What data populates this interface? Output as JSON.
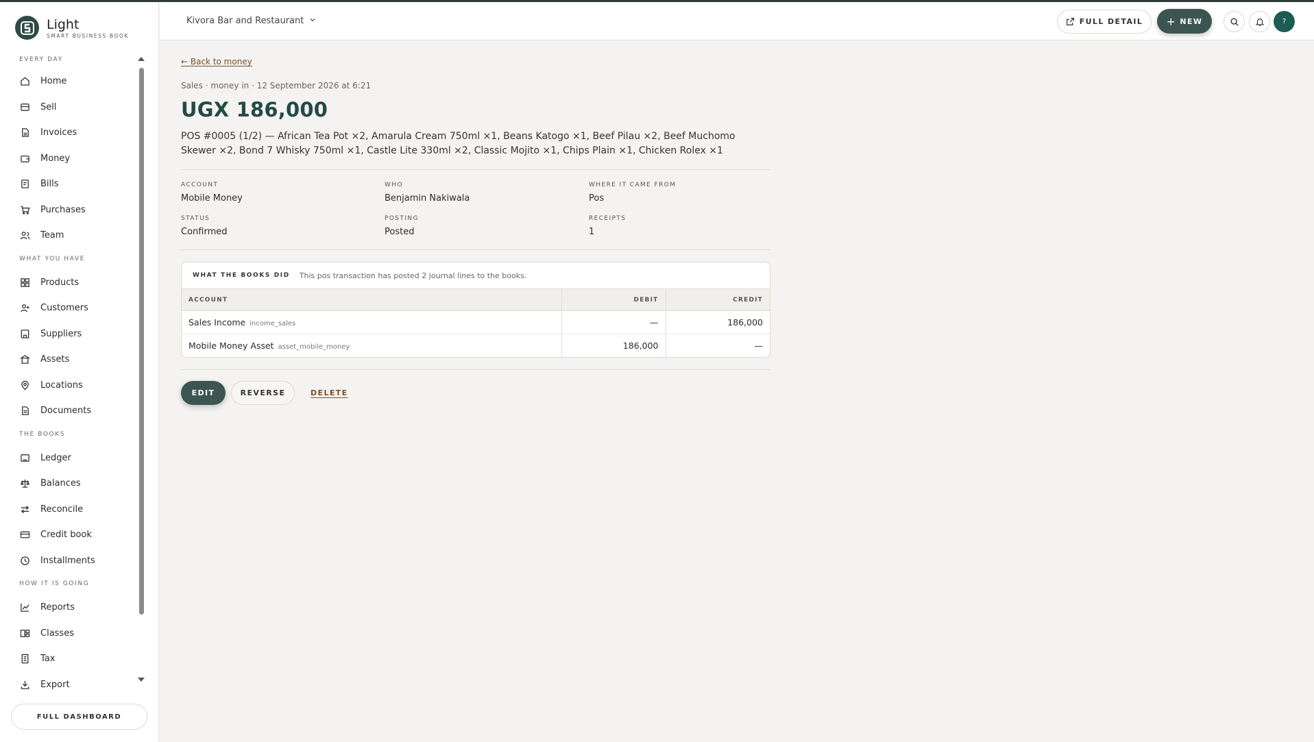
{
  "brand": {
    "name": "Light",
    "subtitle": "SMART BUSINESS BOOK"
  },
  "sidebar": {
    "sections": [
      {
        "title": "EVERY DAY",
        "items": [
          {
            "label": "Home",
            "icon": "home-icon"
          },
          {
            "label": "Sell",
            "icon": "register-icon"
          },
          {
            "label": "Invoices",
            "icon": "invoice-icon"
          },
          {
            "label": "Money",
            "icon": "wallet-icon"
          },
          {
            "label": "Bills",
            "icon": "bill-icon"
          },
          {
            "label": "Purchases",
            "icon": "cart-icon"
          },
          {
            "label": "Team",
            "icon": "team-icon"
          }
        ]
      },
      {
        "title": "WHAT YOU HAVE",
        "items": [
          {
            "label": "Products",
            "icon": "grid-icon"
          },
          {
            "label": "Customers",
            "icon": "customers-icon"
          },
          {
            "label": "Suppliers",
            "icon": "building-icon"
          },
          {
            "label": "Assets",
            "icon": "bank-icon"
          },
          {
            "label": "Locations",
            "icon": "pin-icon"
          },
          {
            "label": "Documents",
            "icon": "document-icon"
          }
        ]
      },
      {
        "title": "THE BOOKS",
        "items": [
          {
            "label": "Ledger",
            "icon": "ledger-icon"
          },
          {
            "label": "Balances",
            "icon": "scale-icon"
          },
          {
            "label": "Reconcile",
            "icon": "swap-icon"
          },
          {
            "label": "Credit book",
            "icon": "credit-card-icon"
          },
          {
            "label": "Installments",
            "icon": "clock-icon"
          }
        ]
      },
      {
        "title": "HOW IT IS GOING",
        "items": [
          {
            "label": "Reports",
            "icon": "chart-line-icon"
          },
          {
            "label": "Classes",
            "icon": "classes-icon"
          },
          {
            "label": "Tax",
            "icon": "receipt-icon"
          },
          {
            "label": "Export",
            "icon": "download-icon"
          }
        ]
      }
    ],
    "full_dashboard_label": "FULL DASHBOARD"
  },
  "header": {
    "business_name": "Kivora Bar and Restaurant",
    "full_detail_label": "FULL DETAIL",
    "new_label": "NEW",
    "avatar_initial": "?"
  },
  "transaction": {
    "back_label": "← Back to money",
    "meta": "Sales · money in · 12 September 2026 at 6:21",
    "amount": "UGX 186,000",
    "description": "POS #0005 (1/2) — African Tea Pot ×2, Amarula Cream 750ml ×1, Beans Katogo ×1, Beef Pilau ×2, Beef Muchomo Skewer ×2, Bond 7 Whisky 750ml ×1, Castle Lite 330ml ×2, Classic Mojito ×1, Chips Plain ×1, Chicken Rolex ×1",
    "fields": {
      "account_label": "ACCOUNT",
      "account": "Mobile Money",
      "who_label": "WHO",
      "who": "Benjamin Nakiwala",
      "source_label": "WHERE IT CAME FROM",
      "source": "Pos",
      "status_label": "STATUS",
      "status": "Confirmed",
      "posting_label": "POSTING",
      "posting": "Posted",
      "receipts_label": "RECEIPTS",
      "receipts": "1"
    }
  },
  "books": {
    "title": "WHAT THE BOOKS DID",
    "note": "This pos transaction has posted 2 journal lines to the books.",
    "columns": {
      "account": "ACCOUNT",
      "debit": "DEBIT",
      "credit": "CREDIT"
    },
    "rows": [
      {
        "account": "Sales Income",
        "code": "income_sales",
        "debit": "—",
        "credit": "186,000"
      },
      {
        "account": "Mobile Money Asset",
        "code": "asset_mobile_money",
        "debit": "186,000",
        "credit": "—"
      }
    ]
  },
  "actions": {
    "edit": "EDIT",
    "reverse": "REVERSE",
    "delete": "DELETE"
  },
  "colors": {
    "brand_dark": "#2e4a45",
    "accent": "#3c5550",
    "amount": "#234a47",
    "link": "#7a4e2a"
  }
}
